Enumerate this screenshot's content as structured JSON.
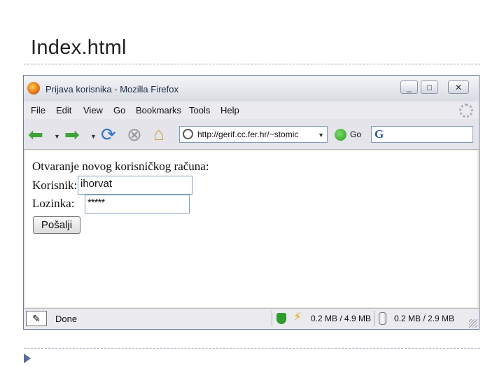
{
  "slide": {
    "title": "Index.html"
  },
  "window": {
    "title": "Prijava korisnika - Mozilla Firefox",
    "buttons": {
      "minimize": "_",
      "maximize": "□",
      "close": "✕"
    },
    "menu": [
      "File",
      "Edit",
      "View",
      "Go",
      "Bookmarks",
      "Tools",
      "Help"
    ],
    "address": "http://gerif.cc.fer.hr/~stomic",
    "go_label": "Go",
    "search_icon_label": "G"
  },
  "form": {
    "heading": "Otvaranje novog korisničkog računa:",
    "username_label": "Korisnik:",
    "username_value": "ihorvat",
    "password_label": "Lozinka:",
    "password_mask": "*****",
    "submit_label": "Pošalji"
  },
  "status": {
    "text": "Done",
    "memory1": "0.2 MB / 4.9 MB",
    "memory2": "0.2 MB / 2.9 MB"
  },
  "icons": {
    "back": "back-arrow-icon",
    "forward": "forward-arrow-icon",
    "reload": "reload-icon",
    "stop": "stop-icon",
    "home": "home-icon",
    "go": "go-icon"
  },
  "colors": {
    "accent": "#2451a6",
    "nav_green": "#3ca536",
    "rule": "#9aa3b8"
  }
}
